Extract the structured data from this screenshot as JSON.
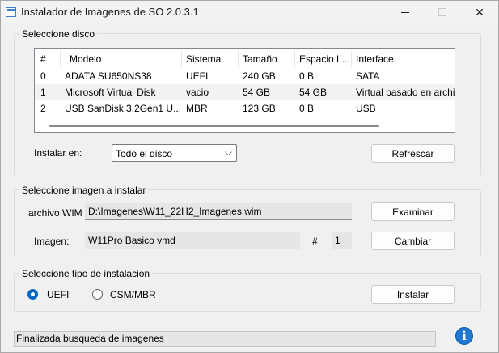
{
  "window": {
    "title": "Instalador de Imagenes de SO 2.0.3.1"
  },
  "disk_group": {
    "label": "Seleccione disco",
    "columns": [
      "#",
      "Modelo",
      "Sistema",
      "Tamaño",
      "Espacio L...",
      "Interface"
    ],
    "rows": [
      {
        "num": "0",
        "model": "ADATA SU650NS38",
        "system": "UEFI",
        "size": "240 GB",
        "free": "0 B",
        "iface": "SATA"
      },
      {
        "num": "1",
        "model": "Microsoft Virtual Disk",
        "system": "vacio",
        "size": "54 GB",
        "free": "54 GB",
        "iface": "Virtual basado en archivo"
      },
      {
        "num": "2",
        "model": "USB  SanDisk 3.2Gen1 U...",
        "system": "MBR",
        "size": "123 GB",
        "free": "0 B",
        "iface": "USB"
      }
    ],
    "install_on_label": "Instalar en:",
    "install_on_value": "Todo el disco",
    "refresh_label": "Refrescar"
  },
  "image_group": {
    "label": "Seleccione imagen a instalar",
    "wim_label": "archivo WIM",
    "wim_value": "D:\\Imagenes\\W11_22H2_Imagenes.wim",
    "browse_label": "Examinar",
    "image_label": "Imagen:",
    "image_value": "W11Pro Basico vmd",
    "index_label": "#",
    "index_value": "1",
    "change_label": "Cambiar"
  },
  "install_group": {
    "label": "Seleccione tipo de instalacion",
    "uefi_label": "UEFI",
    "csm_label": "CSM/MBR",
    "selected": "UEFI",
    "install_label": "Instalar"
  },
  "status": {
    "text": "Finalizada busqueda de imagenes"
  },
  "icons": {
    "app": "app-window-icon",
    "info": "info-icon",
    "dropdown": "chevron-down-icon"
  },
  "colors": {
    "accent": "#0067c0",
    "info": "#1f78d1"
  }
}
